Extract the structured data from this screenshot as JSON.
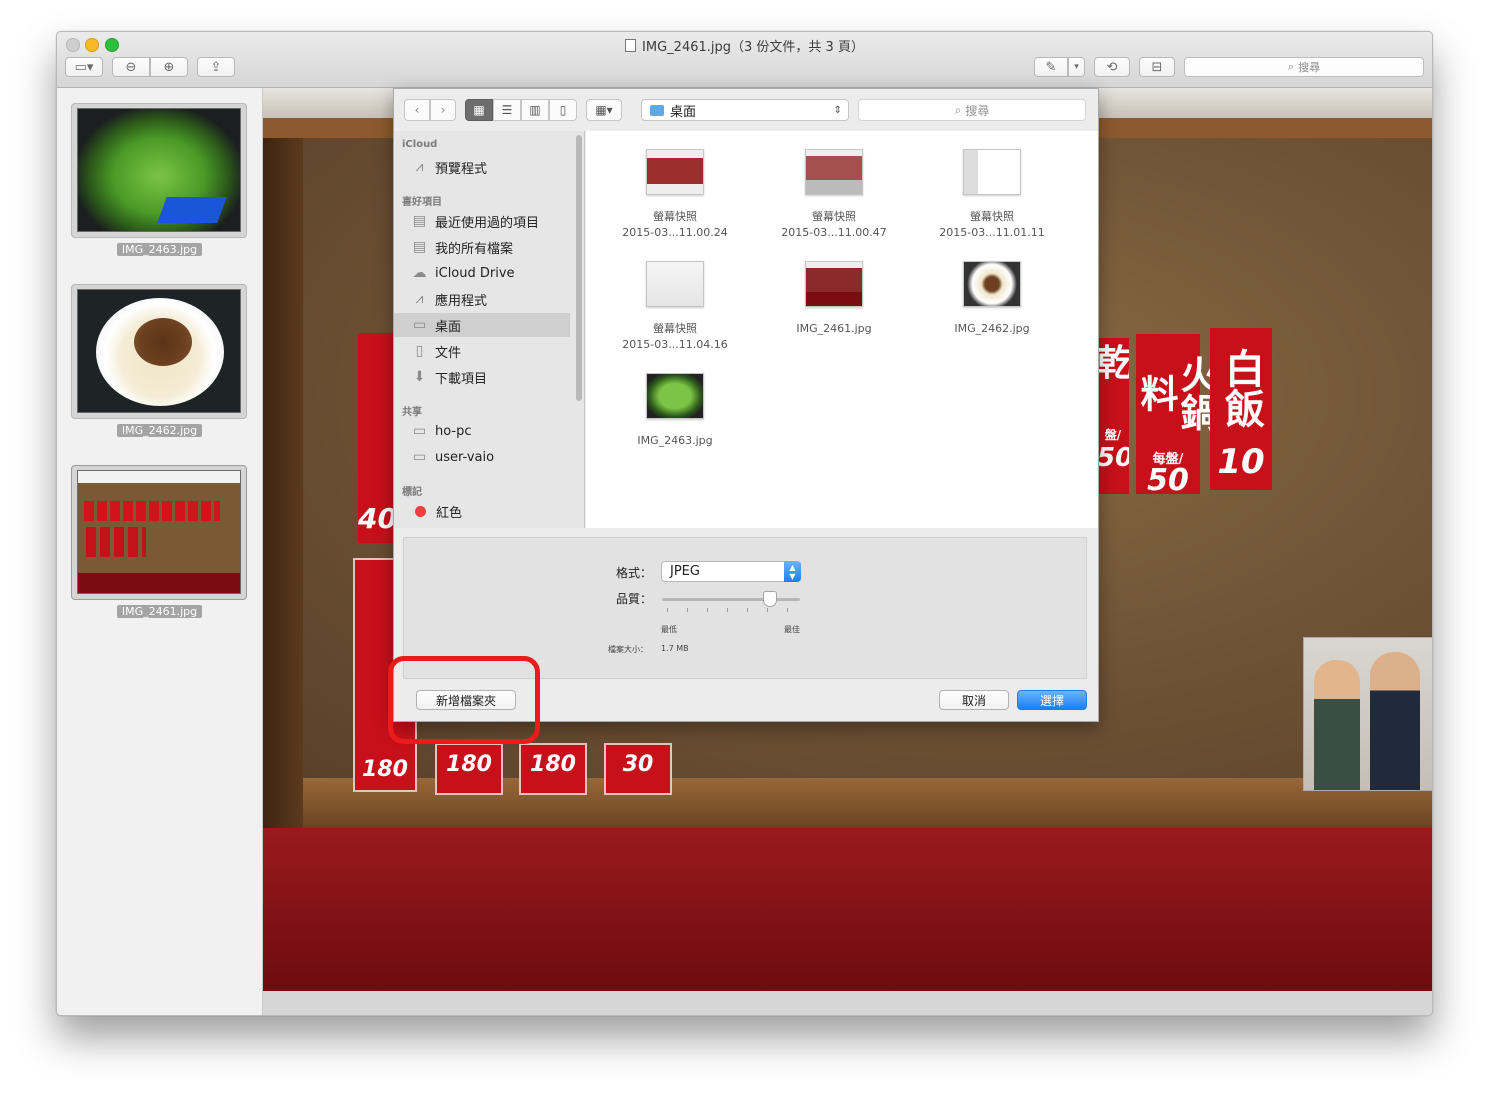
{
  "window": {
    "title": "IMG_2461.jpg（3 份文件，共 3 頁）"
  },
  "toolbar": {
    "search_placeholder": "搜尋",
    "sidebar_toggle_icon": "sidebar-icon",
    "zoom_out_icon": "zoom-out-icon",
    "zoom_in_icon": "zoom-in-icon",
    "share_icon": "share-icon",
    "markup_icon": "pencil-icon",
    "rotate_icon": "rotate-icon",
    "toolbox_icon": "toolbox-icon"
  },
  "thumbnails": [
    {
      "label": "IMG_2463.jpg",
      "subject": "green vegetables"
    },
    {
      "label": "IMG_2462.jpg",
      "subject": "braised pork rice"
    },
    {
      "label": "IMG_2461.jpg",
      "subject": "restaurant menu wall"
    }
  ],
  "photo": {
    "signs": [
      {
        "text": "火鍋料",
        "sub": "每盤/",
        "price": "50"
      },
      {
        "text": "白飯",
        "price": "10"
      },
      {
        "text": "乾",
        "sub": "盤/",
        "price": "50"
      }
    ],
    "left_prices": [
      "40",
      "180",
      "180",
      "180",
      "30"
    ]
  },
  "sheet": {
    "location": "桌面",
    "search_placeholder": "搜尋",
    "sources": {
      "icloud_header": "iCloud",
      "icloud_items": [
        {
          "label": "預覽程式",
          "icon": "app-icon"
        }
      ],
      "favorites_header": "喜好項目",
      "favorites": [
        {
          "label": "最近使用過的項目",
          "icon": "recents-icon"
        },
        {
          "label": "我的所有檔案",
          "icon": "all-files-icon"
        },
        {
          "label": "iCloud Drive",
          "icon": "cloud-icon"
        },
        {
          "label": "應用程式",
          "icon": "applications-icon"
        },
        {
          "label": "桌面",
          "icon": "desktop-icon",
          "selected": true
        },
        {
          "label": "文件",
          "icon": "documents-icon"
        },
        {
          "label": "下載項目",
          "icon": "downloads-icon"
        }
      ],
      "shared_header": "共享",
      "shared": [
        {
          "label": "ho-pc",
          "icon": "computer-icon"
        },
        {
          "label": "user-vaio",
          "icon": "computer-icon"
        }
      ],
      "tags_header": "標記",
      "tags": [
        {
          "label": "紅色",
          "color": "#ef3f3f"
        }
      ]
    },
    "files": [
      {
        "line1": "螢幕快照",
        "line2": "2015-03...11.00.24"
      },
      {
        "line1": "螢幕快照",
        "line2": "2015-03...11.00.47"
      },
      {
        "line1": "螢幕快照",
        "line2": "2015-03...11.01.11"
      },
      {
        "line1": "螢幕快照",
        "line2": "2015-03...11.04.16"
      },
      {
        "line1": "IMG_2461.jpg",
        "line2": ""
      },
      {
        "line1": "IMG_2462.jpg",
        "line2": ""
      },
      {
        "line1": "IMG_2463.jpg",
        "line2": ""
      }
    ],
    "options": {
      "format_label": "格式：",
      "format_value": "JPEG",
      "quality_label": "品質：",
      "quality_min": "最低",
      "quality_max": "最佳",
      "quality_level": 0.78,
      "filesize_label": "檔案大小：",
      "filesize_value": "1.7 MB"
    },
    "buttons": {
      "new_folder": "新增檔案夾",
      "cancel": "取消",
      "choose": "選擇"
    }
  },
  "colors": {
    "accent": "#1b7ef3",
    "highlight_box": "#ec1a1a",
    "sign_red": "#c8101a"
  }
}
